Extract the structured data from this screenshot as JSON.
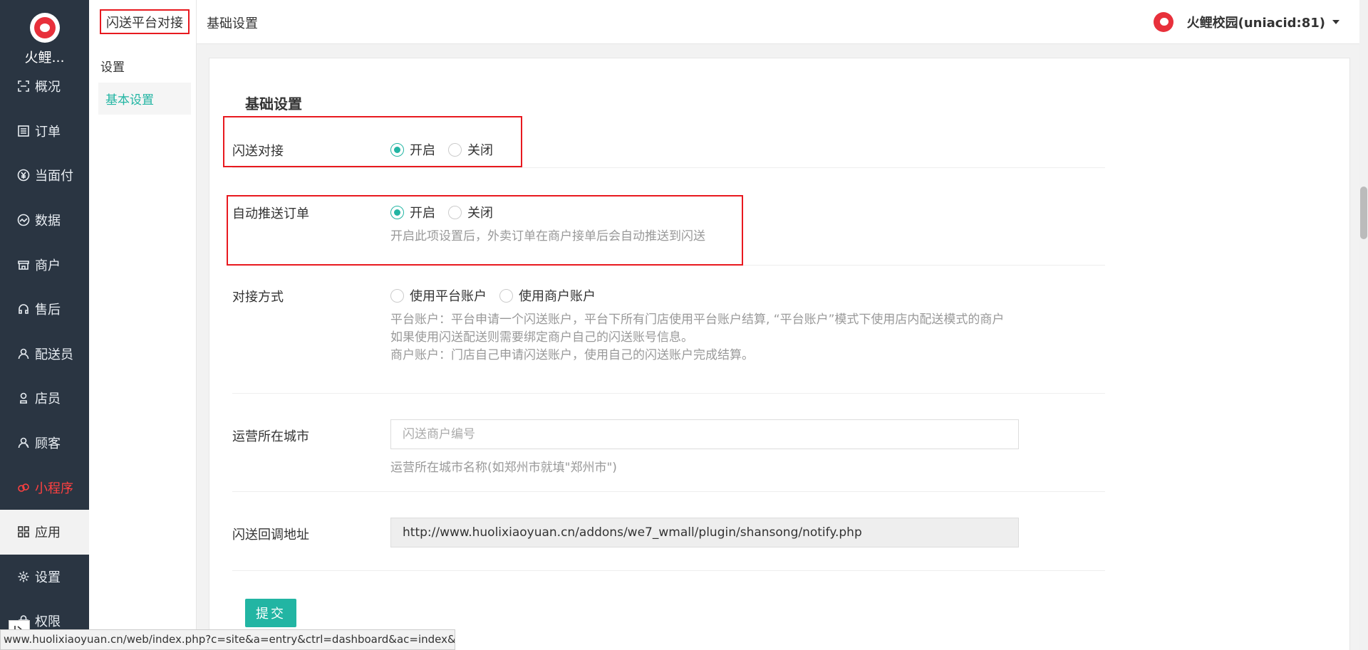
{
  "brand": {
    "name": "火鲤..."
  },
  "nav": [
    {
      "label": "概况",
      "icon": "overview-icon"
    },
    {
      "label": "订单",
      "icon": "order-icon"
    },
    {
      "label": "当面付",
      "icon": "yen-icon"
    },
    {
      "label": "数据",
      "icon": "chart-icon"
    },
    {
      "label": "商户",
      "icon": "store-icon"
    },
    {
      "label": "售后",
      "icon": "headset-icon"
    },
    {
      "label": "配送员",
      "icon": "courier-icon"
    },
    {
      "label": "店员",
      "icon": "clerk-icon"
    },
    {
      "label": "顾客",
      "icon": "customer-icon"
    },
    {
      "label": "小程序",
      "icon": "miniapp-icon"
    },
    {
      "label": "应用",
      "icon": "apps-icon"
    },
    {
      "label": "设置",
      "icon": "gear-icon"
    },
    {
      "label": "权限",
      "icon": "permission-icon"
    }
  ],
  "subnav": {
    "title": "闪送平台对接",
    "group": "设置",
    "items": [
      "基本设置"
    ]
  },
  "header": {
    "title": "基础设置",
    "user": "火鲤校园(uniacid:81)"
  },
  "form": {
    "section_title": "基础设置",
    "shansong_dock": {
      "label": "闪送对接",
      "options": [
        "开启",
        "关闭"
      ],
      "selected": "开启"
    },
    "auto_push": {
      "label": "自动推送订单",
      "options": [
        "开启",
        "关闭"
      ],
      "selected": "开启",
      "help": "开启此项设置后，外卖订单在商户接单后会自动推送到闪送"
    },
    "dock_method": {
      "label": "对接方式",
      "options": [
        "使用平台账户",
        "使用商户账户"
      ],
      "selected": "",
      "help": [
        "平台账户：平台申请一个闪送账户，平台下所有门店使用平台账户结算, “平台账户”模式下使用店内配送模式的商户",
        "如果使用闪送配送则需要绑定商户自己的闪送账号信息。",
        "商户账户：门店自己申请闪送账户，使用自己的闪送账户完成结算。"
      ]
    },
    "city": {
      "label": "运营所在城市",
      "placeholder": "闪送商户编号",
      "value": "",
      "help": "运营所在城市名称(如郑州市就填\"郑州市\")"
    },
    "callback": {
      "label": "闪送回调地址",
      "value": "http://www.huolixiaoyuan.cn/addons/we7_wmall/plugin/shansong/notify.php"
    },
    "submit_label": "提交"
  },
  "status_url": "www.huolixiaoyuan.cn/web/index.php?c=site&a=entry&ctrl=dashboard&ac=index&..."
}
